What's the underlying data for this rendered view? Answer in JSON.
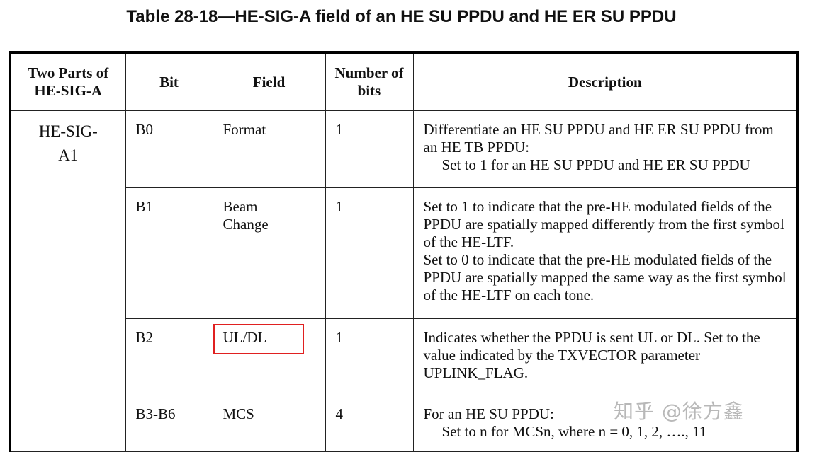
{
  "title": "Table 28-18—HE-SIG-A field of an HE SU PPDU and HE ER SU PPDU",
  "headers": [
    "Two Parts of HE-SIG-A",
    "Bit",
    "Field",
    "Number of bits",
    "Description"
  ],
  "part": "HE-SIG-A1",
  "rows": [
    {
      "bit": "B0",
      "field": "Format",
      "nbits": "1",
      "desc": [
        "Differentiate an HE SU PPDU and HE ER SU PPDU from an HE TB PPDU:"
      ],
      "desc_indent": "Set to 1 for an HE SU PPDU and HE ER SU PPDU"
    },
    {
      "bit": "B1",
      "field": "Beam Change",
      "nbits": "1",
      "desc": [
        "Set to 1 to indicate that the pre-HE modulated fields of the PPDU are spatially mapped differently from the first symbol of the HE-LTF.",
        "Set to 0 to indicate that the pre-HE modulated fields of the PPDU are spatially mapped the same way as the first symbol of the HE-LTF on each tone."
      ]
    },
    {
      "bit": "B2",
      "field": "UL/DL",
      "nbits": "1",
      "highlighted": true,
      "desc": [
        "Indicates whether the PPDU is sent UL or DL. Set to the value indicated by the TXVECTOR parameter UPLINK_FLAG."
      ]
    },
    {
      "bit": "B3-B6",
      "field": "MCS",
      "nbits": "4",
      "desc": [
        "For an HE SU PPDU:"
      ],
      "desc_indent": "Set to n for MCSn, where n = 0, 1, 2, …., 11"
    }
  ],
  "watermark": "知乎 @徐方鑫",
  "highlight_color": "#e02020"
}
